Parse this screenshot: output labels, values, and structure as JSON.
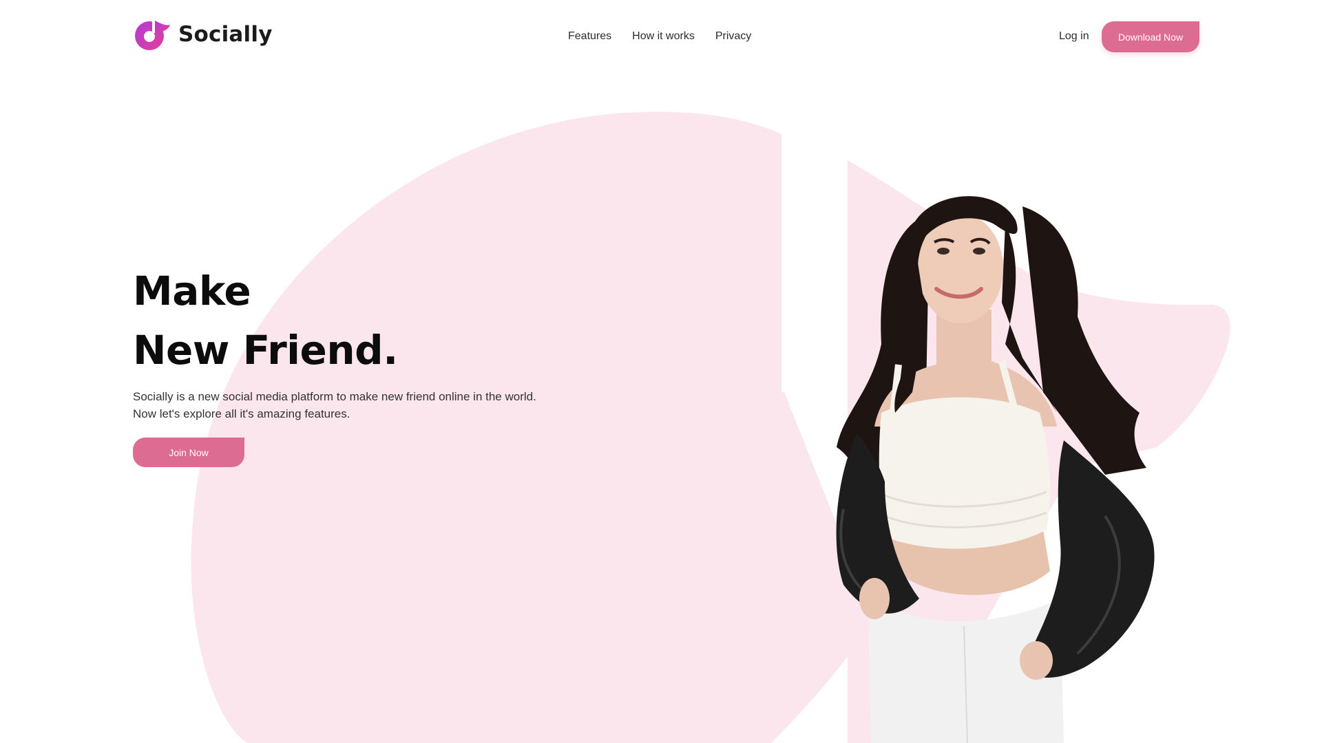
{
  "brand": {
    "name": "Socially",
    "accent_color": "#dc6c91",
    "logo_gradient": [
      "#b43ad6",
      "#e0409a"
    ],
    "background_shape_color": "#fbe6ee"
  },
  "nav": {
    "items": [
      {
        "label": "Features"
      },
      {
        "label": "How it works"
      },
      {
        "label": "Privacy"
      }
    ],
    "login_label": "Log in",
    "download_label": "Download Now"
  },
  "hero": {
    "title_line1": "Make",
    "title_line2": "New Friend.",
    "description": "Socially is a new social media platform to make new friend online in the world. Now let's explore all it's amazing features.",
    "cta_label": "Join Now"
  }
}
